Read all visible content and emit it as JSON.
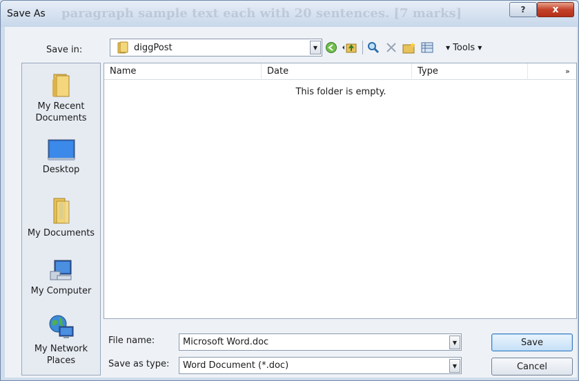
{
  "window": {
    "title": "Save As",
    "background_title_ghost": "paragraph sample text each with 20 sentences. [7 marks]",
    "help_symbol": "?",
    "close_symbol": "x"
  },
  "toolbar": {
    "save_in_label": "Save in:",
    "save_in_value": "diggPost",
    "tools_label": "Tools"
  },
  "places": [
    {
      "label_line1": "My Recent",
      "label_line2": "Documents",
      "icon": "recent-documents-icon"
    },
    {
      "label_line1": "Desktop",
      "label_line2": "",
      "icon": "desktop-icon"
    },
    {
      "label_line1": "My Documents",
      "label_line2": "",
      "icon": "my-documents-icon"
    },
    {
      "label_line1": "My Computer",
      "label_line2": "",
      "icon": "my-computer-icon"
    },
    {
      "label_line1": "My Network",
      "label_line2": "Places",
      "icon": "network-places-icon"
    }
  ],
  "file_list": {
    "columns": [
      "Name",
      "Date",
      "Type"
    ],
    "more_indicator": "»",
    "empty_message": "This folder is empty."
  },
  "fields": {
    "file_name_label": "File name:",
    "file_name_value": "Microsoft Word.doc",
    "save_as_type_label": "Save as type:",
    "save_as_type_value": "Word Document (*.doc)"
  },
  "buttons": {
    "save": "Save",
    "cancel": "Cancel"
  },
  "colors": {
    "title_bar": "#c7d7ea",
    "close_button": "#c4422a",
    "folder_yellow": "#e8c25a",
    "default_button_border": "#3d7bbd"
  }
}
